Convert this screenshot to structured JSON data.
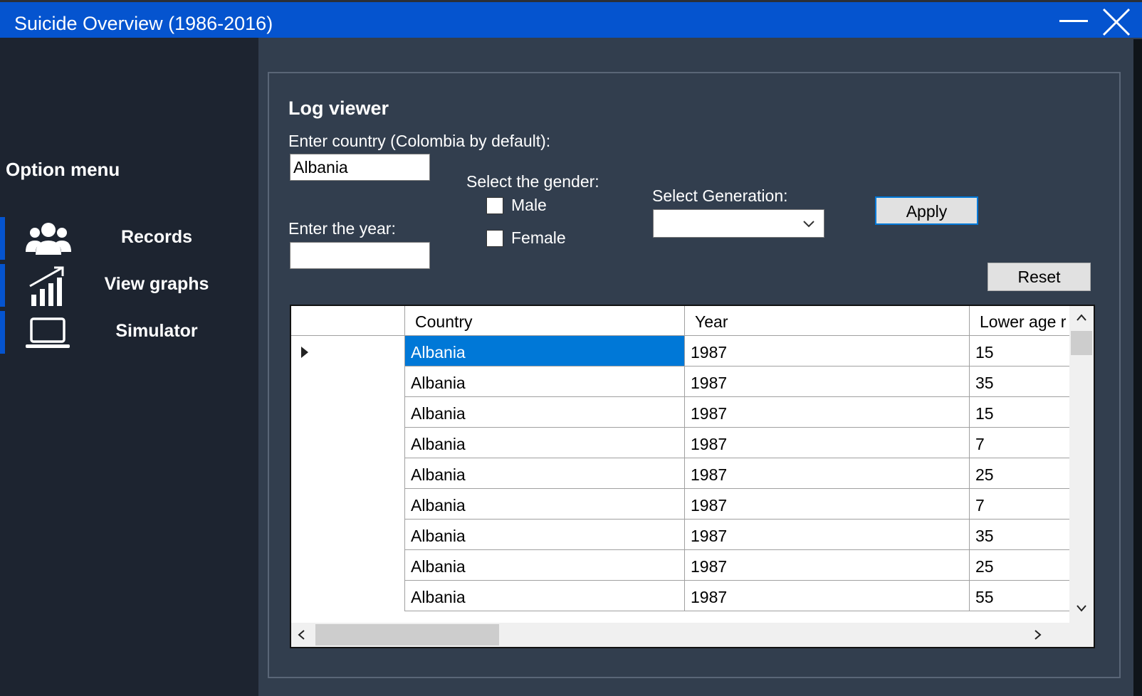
{
  "window": {
    "title": "Suicide Overview (1986-2016)"
  },
  "sidebar": {
    "title": "Option menu",
    "items": [
      {
        "label": "Records",
        "icon": "users-icon"
      },
      {
        "label": "View graphs",
        "icon": "bar-chart-icon"
      },
      {
        "label": "Simulator",
        "icon": "laptop-icon"
      }
    ]
  },
  "panel": {
    "title": "Log viewer",
    "country_label": "Enter country (Colombia by default):",
    "country_value": "Albania",
    "year_label": "Enter the year:",
    "year_value": "",
    "gender_label": "Select the gender:",
    "gender_male": "Male",
    "gender_female": "Female",
    "generation_label": "Select Generation:",
    "generation_value": "",
    "apply_label": "Apply",
    "reset_label": "Reset"
  },
  "table": {
    "columns": [
      "Country",
      "Year",
      "Lower age r"
    ],
    "rows": [
      [
        "Albania",
        "1987",
        "15"
      ],
      [
        "Albania",
        "1987",
        "35"
      ],
      [
        "Albania",
        "1987",
        "15"
      ],
      [
        "Albania",
        "1987",
        "7"
      ],
      [
        "Albania",
        "1987",
        "25"
      ],
      [
        "Albania",
        "1987",
        "7"
      ],
      [
        "Albania",
        "1987",
        "35"
      ],
      [
        "Albania",
        "1987",
        "25"
      ],
      [
        "Albania",
        "1987",
        "55"
      ]
    ],
    "selected_row": 0
  },
  "colors": {
    "titlebar": "#0554cf",
    "sidebar": "#1d2430",
    "panel": "#323e4e",
    "selection": "#0078d7"
  }
}
